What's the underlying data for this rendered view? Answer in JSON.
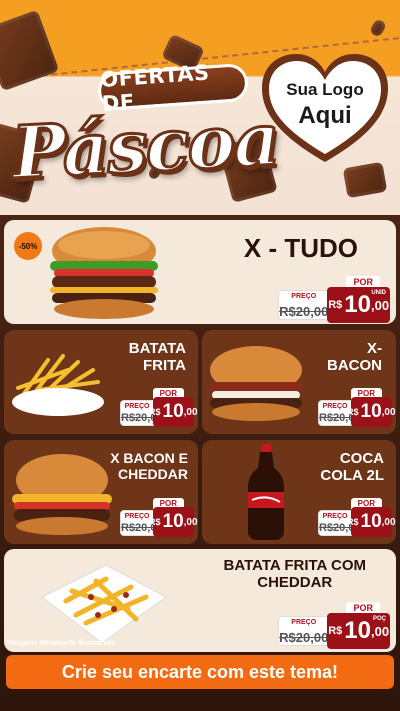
{
  "header": {
    "title_top": "OFERTAS DE",
    "title_main": "Páscoa",
    "logo_line1": "Sua Logo",
    "logo_line2": "Aqui"
  },
  "featured": {
    "badge": "-50%",
    "name": "X - TUDO",
    "price_label": "PREÇO",
    "old_price": "R$20,00",
    "por_label": "POR",
    "currency": "R$",
    "price": "10",
    "cents": ",00",
    "unit": "UNID"
  },
  "items": [
    {
      "name_line1": "BATATA",
      "name_line2": "FRITA",
      "price_label": "PREÇO",
      "old_price": "R$20,00",
      "por_label": "POR",
      "currency": "R$",
      "price": "10",
      "cents": ",00"
    },
    {
      "name_line1": "X-",
      "name_line2": "BACON",
      "price_label": "PREÇO",
      "old_price": "R$20,00",
      "por_label": "POR",
      "currency": "R$",
      "price": "10",
      "cents": ",00"
    },
    {
      "name_line1": "X BACON E",
      "name_line2": "CHEDDAR",
      "price_label": "PREÇO",
      "old_price": "R$20,00",
      "por_label": "POR",
      "currency": "R$",
      "price": "10",
      "cents": ",00"
    },
    {
      "name_line1": "COCA",
      "name_line2": "COLA 2L",
      "price_label": "PREÇO",
      "old_price": "R$20,00",
      "por_label": "POR",
      "currency": "R$",
      "price": "10",
      "cents": ",00"
    }
  ],
  "bottom_item": {
    "name_line1": "BATATA FRITA COM",
    "name_line2": "CHEDDAR",
    "price_label": "PREÇO",
    "old_price": "R$20,00",
    "por_label": "POR",
    "currency": "R$",
    "price": "10",
    "cents": ",00",
    "unit": "POÇ"
  },
  "footer_note": "*Imagens Meramente Ilustrativas",
  "cta": "Crie seu encarte com este tema!",
  "colors": {
    "orange": "#f59f22",
    "chocolate": "#6e3519",
    "cream": "#f5e9dc",
    "price_red": "#9c1018",
    "cta": "#f26a12"
  }
}
